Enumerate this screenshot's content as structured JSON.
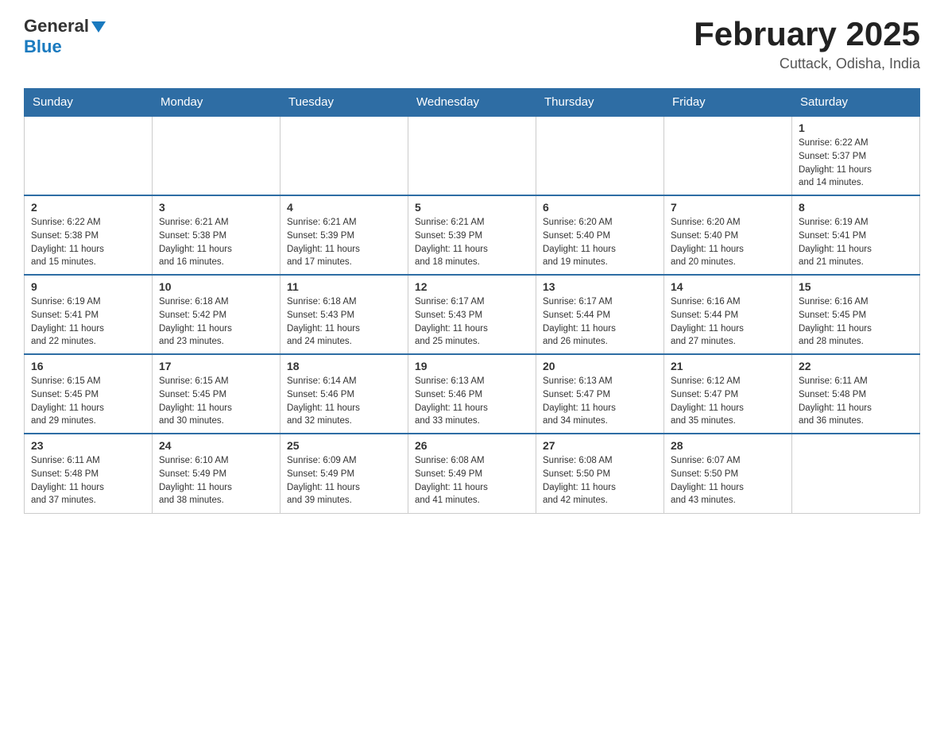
{
  "header": {
    "logo_general": "General",
    "logo_blue": "Blue",
    "month_title": "February 2025",
    "location": "Cuttack, Odisha, India"
  },
  "days_of_week": [
    "Sunday",
    "Monday",
    "Tuesday",
    "Wednesday",
    "Thursday",
    "Friday",
    "Saturday"
  ],
  "weeks": [
    {
      "days": [
        {
          "number": "",
          "info": ""
        },
        {
          "number": "",
          "info": ""
        },
        {
          "number": "",
          "info": ""
        },
        {
          "number": "",
          "info": ""
        },
        {
          "number": "",
          "info": ""
        },
        {
          "number": "",
          "info": ""
        },
        {
          "number": "1",
          "info": "Sunrise: 6:22 AM\nSunset: 5:37 PM\nDaylight: 11 hours\nand 14 minutes."
        }
      ]
    },
    {
      "days": [
        {
          "number": "2",
          "info": "Sunrise: 6:22 AM\nSunset: 5:38 PM\nDaylight: 11 hours\nand 15 minutes."
        },
        {
          "number": "3",
          "info": "Sunrise: 6:21 AM\nSunset: 5:38 PM\nDaylight: 11 hours\nand 16 minutes."
        },
        {
          "number": "4",
          "info": "Sunrise: 6:21 AM\nSunset: 5:39 PM\nDaylight: 11 hours\nand 17 minutes."
        },
        {
          "number": "5",
          "info": "Sunrise: 6:21 AM\nSunset: 5:39 PM\nDaylight: 11 hours\nand 18 minutes."
        },
        {
          "number": "6",
          "info": "Sunrise: 6:20 AM\nSunset: 5:40 PM\nDaylight: 11 hours\nand 19 minutes."
        },
        {
          "number": "7",
          "info": "Sunrise: 6:20 AM\nSunset: 5:40 PM\nDaylight: 11 hours\nand 20 minutes."
        },
        {
          "number": "8",
          "info": "Sunrise: 6:19 AM\nSunset: 5:41 PM\nDaylight: 11 hours\nand 21 minutes."
        }
      ]
    },
    {
      "days": [
        {
          "number": "9",
          "info": "Sunrise: 6:19 AM\nSunset: 5:41 PM\nDaylight: 11 hours\nand 22 minutes."
        },
        {
          "number": "10",
          "info": "Sunrise: 6:18 AM\nSunset: 5:42 PM\nDaylight: 11 hours\nand 23 minutes."
        },
        {
          "number": "11",
          "info": "Sunrise: 6:18 AM\nSunset: 5:43 PM\nDaylight: 11 hours\nand 24 minutes."
        },
        {
          "number": "12",
          "info": "Sunrise: 6:17 AM\nSunset: 5:43 PM\nDaylight: 11 hours\nand 25 minutes."
        },
        {
          "number": "13",
          "info": "Sunrise: 6:17 AM\nSunset: 5:44 PM\nDaylight: 11 hours\nand 26 minutes."
        },
        {
          "number": "14",
          "info": "Sunrise: 6:16 AM\nSunset: 5:44 PM\nDaylight: 11 hours\nand 27 minutes."
        },
        {
          "number": "15",
          "info": "Sunrise: 6:16 AM\nSunset: 5:45 PM\nDaylight: 11 hours\nand 28 minutes."
        }
      ]
    },
    {
      "days": [
        {
          "number": "16",
          "info": "Sunrise: 6:15 AM\nSunset: 5:45 PM\nDaylight: 11 hours\nand 29 minutes."
        },
        {
          "number": "17",
          "info": "Sunrise: 6:15 AM\nSunset: 5:45 PM\nDaylight: 11 hours\nand 30 minutes."
        },
        {
          "number": "18",
          "info": "Sunrise: 6:14 AM\nSunset: 5:46 PM\nDaylight: 11 hours\nand 32 minutes."
        },
        {
          "number": "19",
          "info": "Sunrise: 6:13 AM\nSunset: 5:46 PM\nDaylight: 11 hours\nand 33 minutes."
        },
        {
          "number": "20",
          "info": "Sunrise: 6:13 AM\nSunset: 5:47 PM\nDaylight: 11 hours\nand 34 minutes."
        },
        {
          "number": "21",
          "info": "Sunrise: 6:12 AM\nSunset: 5:47 PM\nDaylight: 11 hours\nand 35 minutes."
        },
        {
          "number": "22",
          "info": "Sunrise: 6:11 AM\nSunset: 5:48 PM\nDaylight: 11 hours\nand 36 minutes."
        }
      ]
    },
    {
      "days": [
        {
          "number": "23",
          "info": "Sunrise: 6:11 AM\nSunset: 5:48 PM\nDaylight: 11 hours\nand 37 minutes."
        },
        {
          "number": "24",
          "info": "Sunrise: 6:10 AM\nSunset: 5:49 PM\nDaylight: 11 hours\nand 38 minutes."
        },
        {
          "number": "25",
          "info": "Sunrise: 6:09 AM\nSunset: 5:49 PM\nDaylight: 11 hours\nand 39 minutes."
        },
        {
          "number": "26",
          "info": "Sunrise: 6:08 AM\nSunset: 5:49 PM\nDaylight: 11 hours\nand 41 minutes."
        },
        {
          "number": "27",
          "info": "Sunrise: 6:08 AM\nSunset: 5:50 PM\nDaylight: 11 hours\nand 42 minutes."
        },
        {
          "number": "28",
          "info": "Sunrise: 6:07 AM\nSunset: 5:50 PM\nDaylight: 11 hours\nand 43 minutes."
        },
        {
          "number": "",
          "info": ""
        }
      ]
    }
  ]
}
